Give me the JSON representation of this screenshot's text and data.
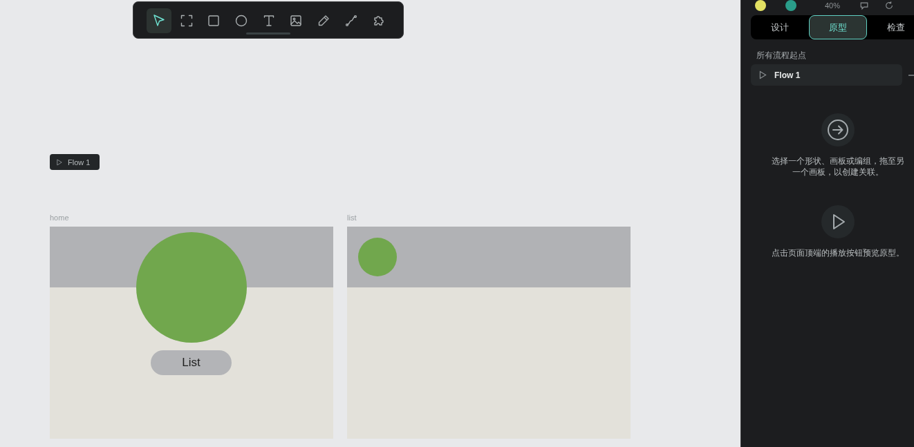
{
  "toolbar": {
    "tools": [
      {
        "kind": "pointer",
        "selected": true
      },
      {
        "kind": "board",
        "selected": false
      },
      {
        "kind": "rect",
        "selected": false
      },
      {
        "kind": "ellipse",
        "selected": false
      },
      {
        "kind": "text",
        "selected": false
      },
      {
        "kind": "image",
        "selected": false
      },
      {
        "kind": "pen",
        "selected": false
      },
      {
        "kind": "path",
        "selected": false
      },
      {
        "kind": "plugins",
        "selected": false
      }
    ]
  },
  "canvas": {
    "flow_badge": {
      "label": "Flow 1"
    },
    "boards": [
      {
        "kind": "hero",
        "name": "home",
        "button": "List"
      },
      {
        "kind": "compact",
        "name": "list"
      }
    ]
  },
  "panel": {
    "header": {
      "zoom": "40%"
    },
    "tabs": [
      {
        "label": "设计",
        "selected": false
      },
      {
        "label": "原型",
        "selected": true
      },
      {
        "label": "检查",
        "selected": false
      }
    ],
    "section_title": "所有流程起点",
    "flows": [
      {
        "label": "Flow 1"
      }
    ],
    "hints": [
      {
        "kind": "link",
        "text": "选择一个形状、画板或编组，拖至另一个画板，以创建关联。"
      },
      {
        "kind": "play",
        "text": "点击页面顶端的播放按钮预览原型。"
      }
    ]
  }
}
